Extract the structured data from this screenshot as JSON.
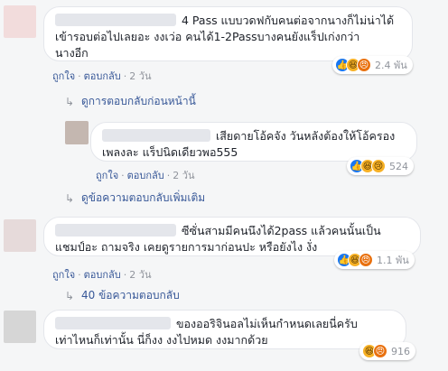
{
  "colors": {
    "link": "#385898",
    "meta": "#90949c",
    "bubble": "#ffffff",
    "page": "#f5f6f7"
  },
  "comments": [
    {
      "line1": "4 Pass แบบวดฟกับคนต่อจากนางก็ไม่น่าได้",
      "line2": "เข้ารอบต่อไปเลยอะ งงเว่อ คนได้1-2Passบางคนยังแร็ปเก่งกว่า",
      "line3": "นางอีก",
      "like": "ถูกใจ",
      "reply": "ตอบกลับ",
      "time": "2 วัน",
      "reaction_count": "2.4 พัน",
      "reactions": [
        "like-icon",
        "haha-icon",
        "angry-icon"
      ]
    },
    {
      "line1": "เสียดายโอ้คจัง วันหลังต้องให้โอ้ครอง",
      "line2": "เพลงละ แร็ปนิดเดียวพอ555",
      "like": "ถูกใจ",
      "reply": "ตอบกลับ",
      "time": "2 วัน",
      "reaction_count": "524",
      "reactions": [
        "like-icon",
        "haha-icon",
        "sad-icon"
      ]
    },
    {
      "line1": "ซีซั่นสามมีคนนึงได้2pass แล้วคนนั้นเป็น",
      "line2": "แชมป์อะ ถามจริง เคยดูรายการมาก่อนปะ หรือยังไง งั่ง",
      "like": "ถูกใจ",
      "reply": "ตอบกลับ",
      "time": "2 วัน",
      "reaction_count": "1.1 พัน",
      "reactions": [
        "like-icon",
        "haha-icon",
        "angry-icon"
      ]
    },
    {
      "line1": "ของออริจินอลไม่เห็นกำหนดเลยนี่ครับ",
      "line2": "เท่าไหนก็เท่านั้น นี่ก็งง งงไปหมด งงมากด้วย",
      "reaction_count": "916",
      "reactions": [
        "haha-icon",
        "angry-icon"
      ]
    }
  ],
  "links": {
    "previous_replies": "ดูการตอบกลับก่อนหน้านี้",
    "more_replies": "ดูข้อความตอบกลับเพิ่มเติม",
    "replies_40": "40 ข้อความตอบกลับ"
  }
}
